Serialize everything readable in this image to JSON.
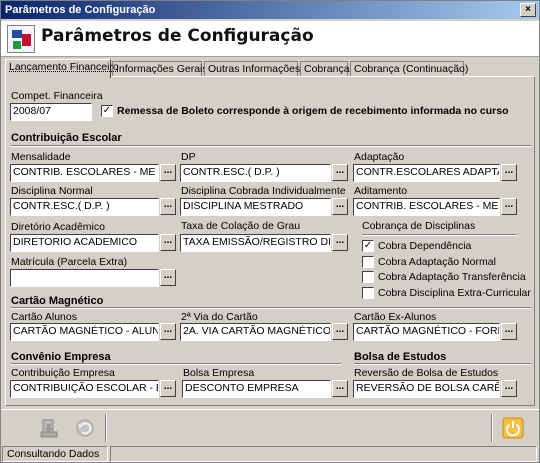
{
  "window": {
    "title": "Parâmetros de Configuração",
    "close_glyph": "×"
  },
  "header": {
    "title": "Parâmetros de Configuração",
    "logo_icon": "app-logo-icon"
  },
  "tabs": [
    {
      "label": "Lançamento Financeiro",
      "active": true
    },
    {
      "label": "Informações Gerais",
      "active": false
    },
    {
      "label": "Outras Informações",
      "active": false
    },
    {
      "label": "Cobrança",
      "active": false
    },
    {
      "label": "Cobrança (Continuação)",
      "active": false
    }
  ],
  "compet": {
    "label": "Compet. Financeira",
    "value": "2008/07",
    "remessa_checked": true,
    "remessa_label": "Remessa de Boleto corresponde à origem de recebimento informada no curso"
  },
  "contribuicao": {
    "title": "Contribuição Escolar",
    "mensalidade": {
      "label": "Mensalidade",
      "value": "CONTRIB.  ESCOLARES - ME"
    },
    "dp": {
      "label": "DP",
      "value": "CONTR.ESC.( D.P. )"
    },
    "adaptacao": {
      "label": "Adaptação",
      "value": "CONTR.ESCOLARES ADAPTAÇÃO"
    },
    "disciplina_normal": {
      "label": "Disciplina Normal",
      "value": "CONTR.ESC.( D.P. )"
    },
    "disciplina_cobrada": {
      "label": "Disciplina Cobrada Individualmente",
      "value": "DISCIPLINA MESTRADO"
    },
    "aditamento": {
      "label": "Aditamento",
      "value": "CONTRIB.  ESCOLARES - ME"
    },
    "diretorio": {
      "label": "Diretório Acadêmico",
      "value": "DIRETORIO ACADEMICO"
    },
    "colacao": {
      "label": "Taxa de Colação de Grau",
      "value": "TAXA EMISSÃO/REGISTRO DIPLOM"
    },
    "matricula": {
      "label": "Matrícula (Parcela Extra)",
      "value": ""
    }
  },
  "cobranca_disciplinas": {
    "title": "Cobrança de Disciplinas",
    "options": [
      {
        "label": "Cobra Dependência",
        "checked": true
      },
      {
        "label": "Cobra Adaptação Normal",
        "checked": false
      },
      {
        "label": "Cobra Adaptação Transferência",
        "checked": false
      },
      {
        "label": "Cobra Disciplina Extra-Curricular",
        "checked": false
      }
    ]
  },
  "cartao": {
    "title": "Cartão Magnético",
    "alunos": {
      "label": "Cartão Alunos",
      "value": "CARTÃO MAGNÉTICO - ALUNOS"
    },
    "segunda_via": {
      "label": "2ª Via do Cartão",
      "value": "2A. VIA CARTÃO MAGNÉTICO"
    },
    "ex_alunos": {
      "label": "Cartão Ex-Alunos",
      "value": "CARTÃO MAGNÉTICO - FORMADO"
    }
  },
  "convenio": {
    "title": "Convênio Empresa",
    "contribuicao": {
      "label": "Contribuição Empresa",
      "value": "CONTRIBUIÇÃO ESCOLAR - EMPRI"
    },
    "bolsa": {
      "label": "Bolsa Empresa",
      "value": "DESCONTO EMPRESA"
    }
  },
  "bolsa_estudos": {
    "title": "Bolsa de Estudos",
    "reversao": {
      "label": "Reversão de Bolsa de Estudos",
      "value": "REVERSÃO DE BOLSA CARÊNCIA"
    }
  },
  "ellipsis": "...",
  "check_glyph": "✓",
  "toolbar": {
    "icons": [
      "save-icon",
      "undo-icon",
      "exit-power-icon"
    ]
  },
  "status": {
    "text": "Consultando Dados"
  },
  "colors": {
    "title_bar_start": "#0a246a",
    "title_bar_end": "#a6caf0",
    "exit_orange": "#f0a020"
  }
}
